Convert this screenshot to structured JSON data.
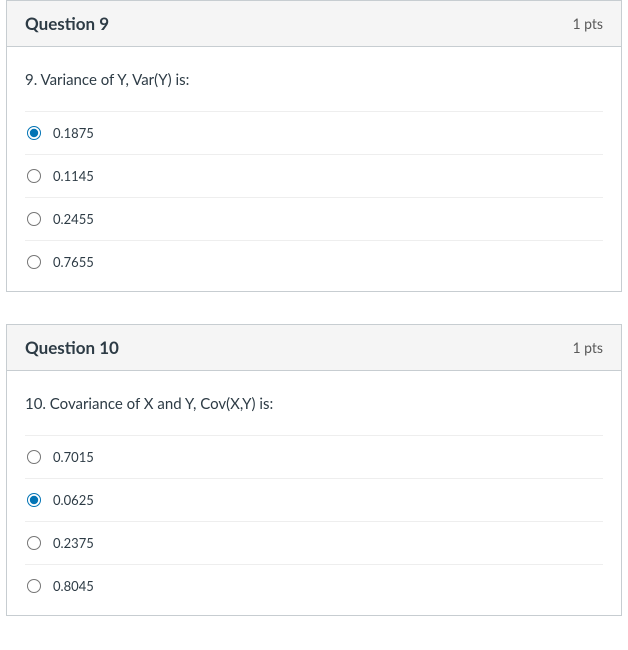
{
  "questions": [
    {
      "title": "Question 9",
      "pts": "1 pts",
      "prompt": "9. Variance of Y, Var(Y) is:",
      "selected": 0,
      "options": [
        {
          "label": "0.1875"
        },
        {
          "label": "0.1145"
        },
        {
          "label": "0.2455"
        },
        {
          "label": "0.7655"
        }
      ]
    },
    {
      "title": "Question 10",
      "pts": "1 pts",
      "prompt": "10. Covariance of X and Y, Cov(X,Y) is:",
      "selected": 1,
      "options": [
        {
          "label": "0.7015"
        },
        {
          "label": "0.0625"
        },
        {
          "label": "0.2375"
        },
        {
          "label": "0.8045"
        }
      ]
    }
  ]
}
